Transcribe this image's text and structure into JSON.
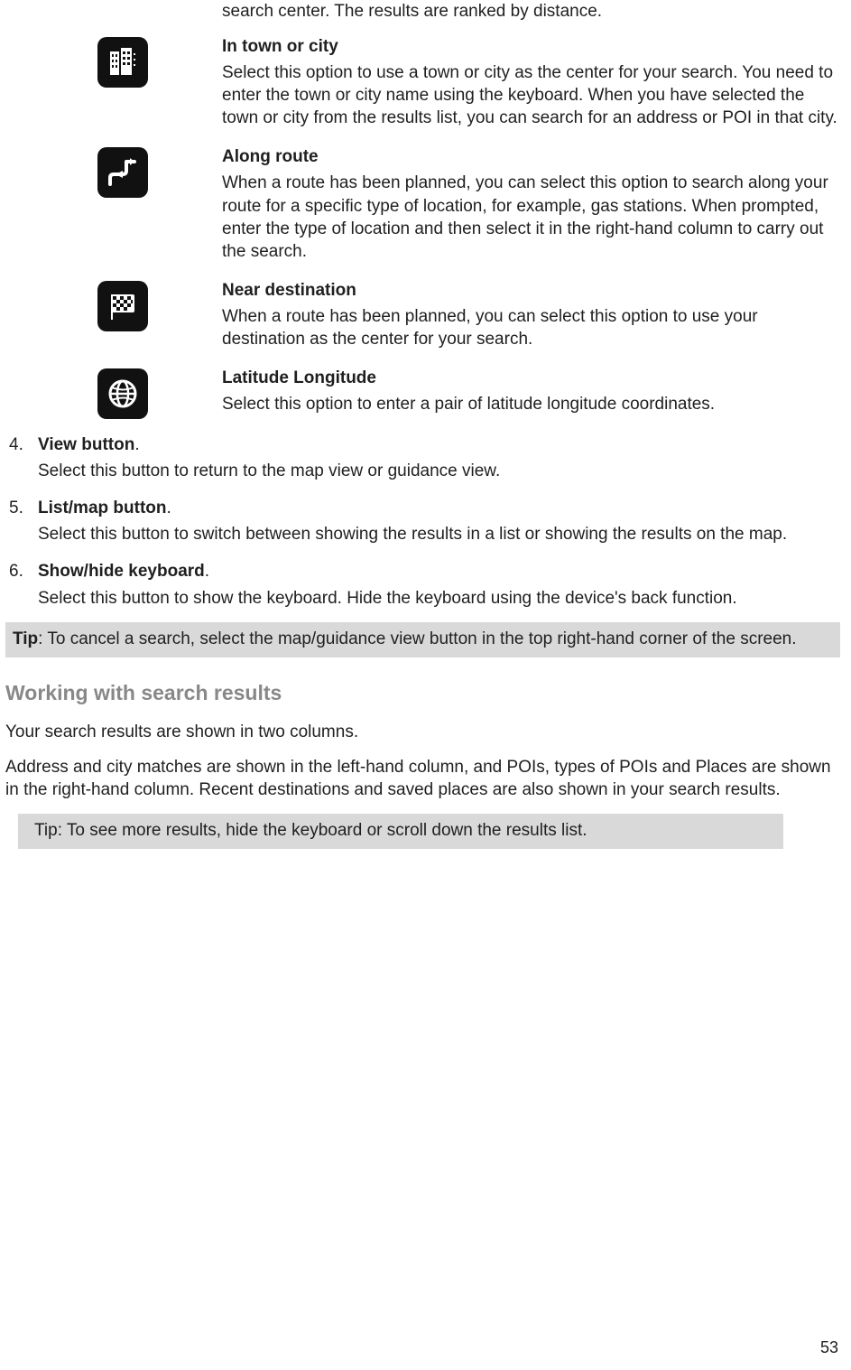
{
  "intro_line": "search center. The results are ranked by distance.",
  "options": [
    {
      "title": "In town or city",
      "desc": "Select this option to use a town or city as the center for your search. You need to enter the town or city name using the keyboard. When you have selected the town or city from the results list, you can search for an address or POI in that city."
    },
    {
      "title": "Along route",
      "desc": "When a route has been planned, you can select this option to search along your route for a specific type of location, for example, gas stations. When prompted, enter the type of location and then select it in the right-hand column to carry out the search."
    },
    {
      "title": "Near destination",
      "desc": "When a route has been planned, you can select this option to use your destination as the center for your search."
    },
    {
      "title": "Latitude Longitude",
      "desc": "Select this option to enter a pair of latitude longitude coordinates."
    }
  ],
  "steps": [
    {
      "num": "4.",
      "title": "View button",
      "desc": "Select this button to return to the map view or guidance view."
    },
    {
      "num": "5.",
      "title": "List/map button",
      "desc": "Select this button to switch between showing the results in a list or showing the results on the map."
    },
    {
      "num": "6.",
      "title": "Show/hide keyboard",
      "desc": "Select this button to show the keyboard. Hide the keyboard using the device's back function."
    }
  ],
  "tip1_label": "Tip",
  "tip1_text": ": To cancel a search, select the map/guidance view button in the top right-hand corner of the screen.",
  "heading": "Working with search results",
  "para1": "Your search results are shown in two columns.",
  "para2": "Address and city matches are shown in the left-hand column, and POIs, types of POIs and Places are shown in the right-hand column. Recent destinations and saved places are also shown in your search results.",
  "tip2_label": "Tip",
  "tip2_text": ": To see more results, hide the keyboard or scroll down the results list.",
  "page_number": "53"
}
